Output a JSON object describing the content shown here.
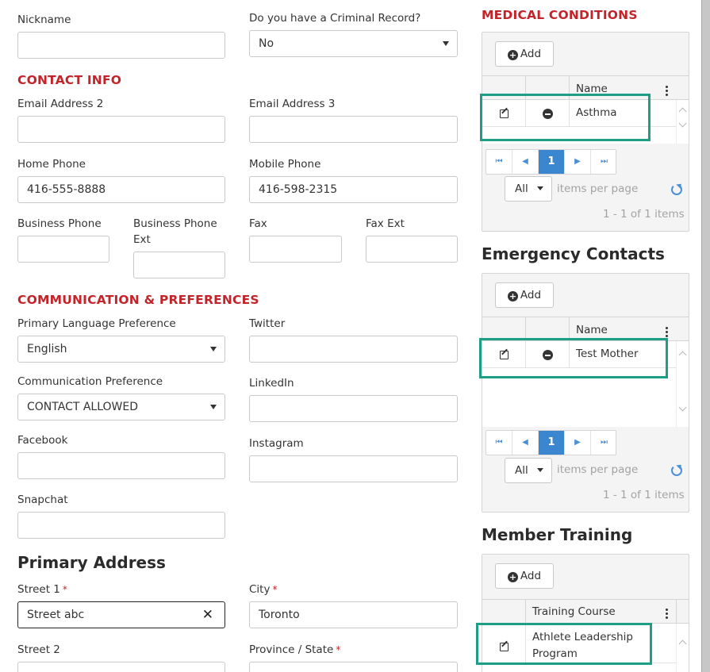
{
  "form": {
    "nickname_label": "Nickname",
    "criminal_label": "Do you have a Criminal Record?",
    "criminal_value": "No",
    "contact_info_heading": "CONTACT INFO",
    "email2_label": "Email Address 2",
    "email3_label": "Email Address 3",
    "home_phone_label": "Home Phone",
    "home_phone_value": "416-555-8888",
    "mobile_phone_label": "Mobile Phone",
    "mobile_phone_value": "416-598-2315",
    "business_phone_label": "Business Phone",
    "business_phone_ext_label_1": "Business Phone",
    "business_phone_ext_label_2": "Ext",
    "fax_label": "Fax",
    "fax_ext_label": "Fax Ext",
    "comm_heading": "COMMUNICATION & PREFERENCES",
    "primary_lang_label": "Primary Language Preference",
    "primary_lang_value": "English",
    "twitter_label": "Twitter",
    "comm_pref_label": "Communication Preference",
    "comm_pref_value": "CONTACT ALLOWED",
    "linkedin_label": "LinkedIn",
    "facebook_label": "Facebook",
    "instagram_label": "Instagram",
    "snapchat_label": "Snapchat",
    "primary_address_heading": "Primary Address",
    "street1_label": "Street 1",
    "street1_value": "Street abc",
    "city_label": "City",
    "city_value": "Toronto",
    "street2_label": "Street 2",
    "province_label": "Province / State",
    "required_mark": "*"
  },
  "medical": {
    "heading": "MEDICAL CONDITIONS",
    "add_label": "Add",
    "col_name": "Name",
    "rows": [
      {
        "name": "Asthma"
      }
    ],
    "page": "1",
    "per_page_value": "All",
    "per_page_label": "items per page",
    "summary": "1 - 1 of 1 items"
  },
  "emergency": {
    "heading": "Emergency Contacts",
    "add_label": "Add",
    "col_name": "Name",
    "rows": [
      {
        "name": "Test Mother"
      }
    ],
    "page": "1",
    "per_page_value": "All",
    "per_page_label": "items per page",
    "summary": "1 - 1 of 1 items"
  },
  "training": {
    "heading": "Member Training",
    "add_label": "Add",
    "col_course": "Training Course",
    "rows": [
      {
        "course_line1": "Athlete Leadership",
        "course_line2": "Program"
      }
    ]
  },
  "icons": {
    "add": "plus-circle-icon",
    "edit": "edit-icon",
    "delete": "minus-circle-icon",
    "menu": "kebab-menu-icon",
    "first": "first-page-icon",
    "prev": "prev-page-icon",
    "next": "next-page-icon",
    "last": "last-page-icon",
    "refresh": "refresh-icon",
    "clear": "clear-icon"
  },
  "colors": {
    "accent_red": "#c3242a",
    "pager_blue": "#3a87cf",
    "highlight_green": "#1f9e86"
  }
}
